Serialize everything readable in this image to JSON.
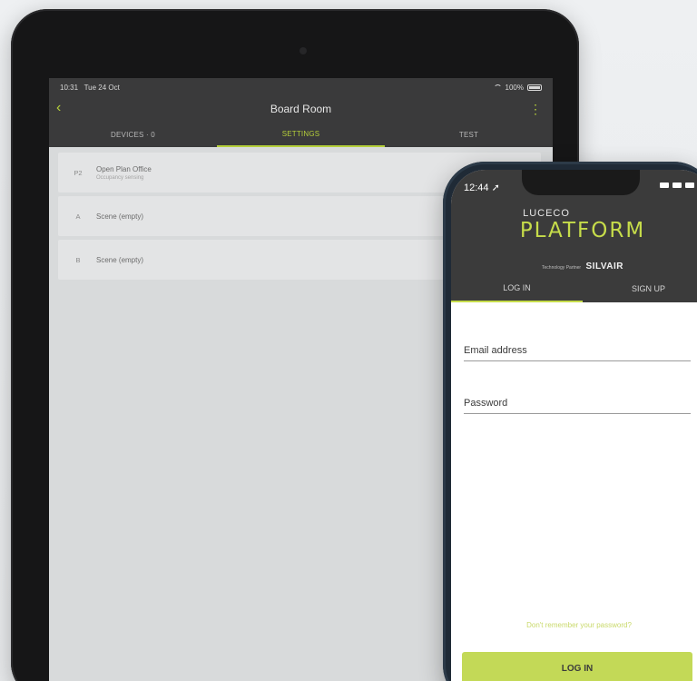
{
  "ipad": {
    "status": {
      "time": "10:31",
      "date": "Tue 24 Oct",
      "battery": "100%"
    },
    "nav": {
      "title": "Board Room",
      "back_icon": "chevron-left-icon",
      "more_icon": "more-vertical-icon"
    },
    "tabs": [
      {
        "label": "DEVICES · 0"
      },
      {
        "label": "SETTINGS",
        "active": true
      },
      {
        "label": "TEST"
      }
    ],
    "cards": [
      {
        "badge": "P2",
        "title": "Open Plan Office",
        "subtitle": "Occupancy sensing"
      },
      {
        "badge": "A",
        "title": "Scene (empty)",
        "subtitle": ""
      },
      {
        "badge": "B",
        "title": "Scene (empty)",
        "subtitle": ""
      }
    ]
  },
  "phone": {
    "status": {
      "time": "12:44"
    },
    "brand": {
      "company": "LUCECO",
      "product": "PLATFORM",
      "partner_label": "Technology Partner",
      "partner_name": "SILVAIR"
    },
    "tabs": [
      {
        "label": "LOG IN",
        "active": true
      },
      {
        "label": "SIGN UP"
      }
    ],
    "form": {
      "email_placeholder": "Email address",
      "password_placeholder": "Password",
      "forgot": "Don't remember your password?",
      "login_label": "LOG IN"
    }
  },
  "colors": {
    "accent": "#c6dc4a",
    "dark_header": "#3b3b3b",
    "ipad_bg": "#d8dadb"
  }
}
